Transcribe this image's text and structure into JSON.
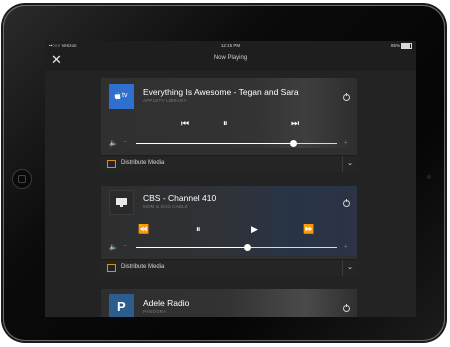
{
  "status_bar": {
    "carrier": "••○○○ Verizon",
    "time": "12:15 PM",
    "battery": "85%"
  },
  "header": {
    "title": "Now Playing"
  },
  "cards": [
    {
      "title": "Everything Is Awesome - Tegan and Sara",
      "subtitle": "APPLETV LIBRARY",
      "icon": "apple-tv-icon",
      "source_label": "tv",
      "volume": 0.78,
      "distribute_label": "Distribute Media"
    },
    {
      "title": "CBS - Channel 410",
      "subtitle": "MOM & DAD CABLE",
      "icon": "tv-icon",
      "volume": 0.55,
      "distribute_label": "Distribute Media"
    },
    {
      "title": "Adele Radio",
      "subtitle": "PANDORA",
      "icon": "pandora-icon",
      "source_label": "P"
    }
  ],
  "colors": {
    "accent": "#e58a1f",
    "apple_tv_blue": "#2f6fce",
    "pandora_blue": "#2b5d8f"
  }
}
